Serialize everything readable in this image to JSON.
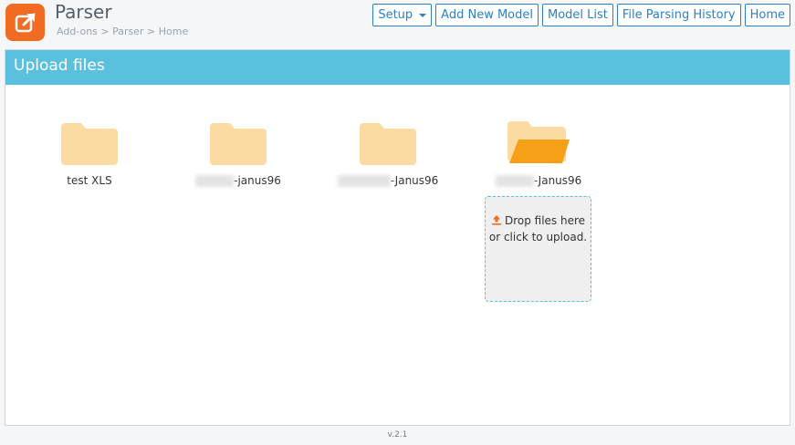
{
  "header": {
    "app_title": "Parser",
    "breadcrumb": "Add-ons > Parser > Home",
    "logo_icon": "external-link-icon",
    "accent_color": "#f26b22"
  },
  "nav": {
    "setup": "Setup",
    "add_new_model": "Add New Model",
    "model_list": "Model List",
    "file_parsing_history": "File Parsing History",
    "home": "Home"
  },
  "panel": {
    "title": "Upload files",
    "header_color": "#5bc0de"
  },
  "folders": [
    {
      "label": "test XLS",
      "icon": "folder-icon"
    },
    {
      "label": "-janus96",
      "icon": "folder-icon"
    },
    {
      "label": "-Janus96",
      "icon": "folder-icon"
    },
    {
      "label": "-Janus96",
      "icon": "folder-open-icon"
    }
  ],
  "dropzone": {
    "text": "Drop files here or click to upload.",
    "icon": "upload-icon"
  },
  "footer": {
    "version": "v.2.1"
  }
}
